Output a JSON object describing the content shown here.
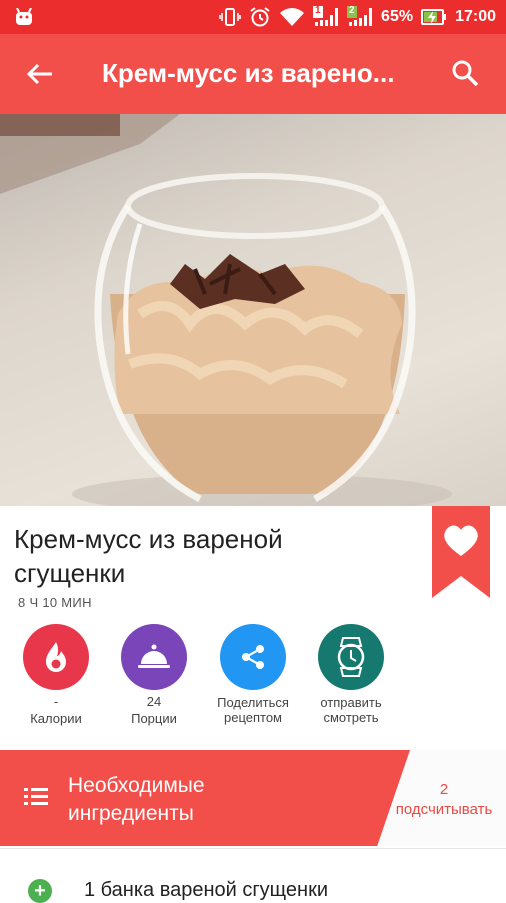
{
  "status_bar": {
    "battery": "65%",
    "time": "17:00",
    "sim1": "1",
    "sim2": "2"
  },
  "app_bar": {
    "title": "Крем-мусс из варено..."
  },
  "recipe": {
    "title": "Крем-мусс из вареной сгущенки",
    "time": "8 Ч 10 МИН"
  },
  "actions": [
    {
      "value": "-",
      "label": "Калории"
    },
    {
      "value": "24",
      "label": "Порции"
    },
    {
      "value": "",
      "label": "Поделиться рецептом"
    },
    {
      "value": "",
      "label": "отправить смотреть"
    }
  ],
  "ingredients_section": {
    "title": "Необходимые ингредиенты",
    "count": "2",
    "count_label": "подсчитывать"
  },
  "ingredients": [
    "1 банка вареной сгущенки"
  ],
  "colors": {
    "status_bar": "#ec2d2d",
    "app_bar": "#f24f4a",
    "calories": "#e8364a",
    "portions": "#7a45b8",
    "share": "#2196f3",
    "watch": "#16796f",
    "add": "#4caf50"
  }
}
